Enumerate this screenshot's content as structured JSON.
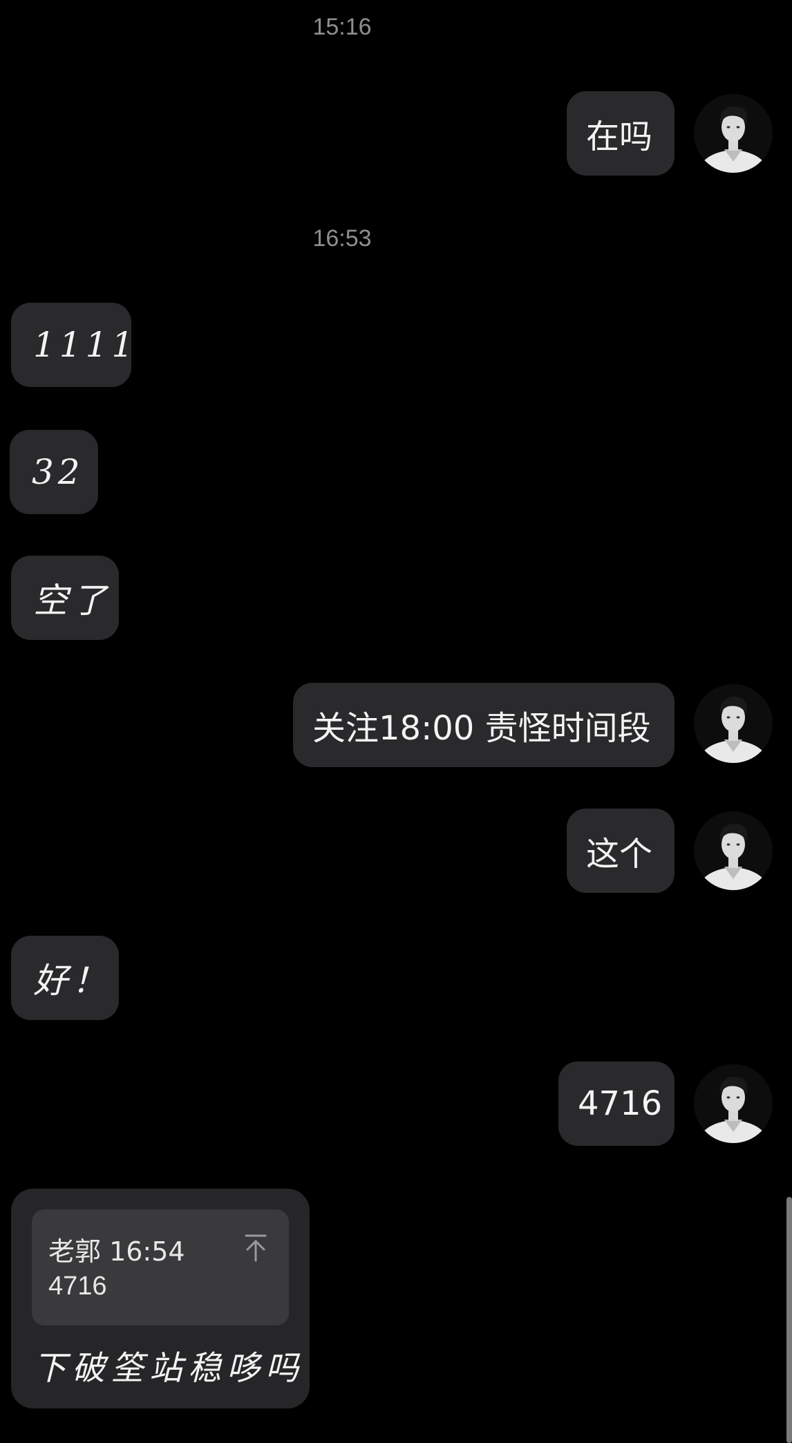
{
  "timestamps": [
    "15:16",
    "16:53"
  ],
  "messages": [
    {
      "dir": "out",
      "text": "在吗"
    },
    {
      "dir": "in",
      "text": "1111"
    },
    {
      "dir": "in",
      "text": "32"
    },
    {
      "dir": "in",
      "text": "空了"
    },
    {
      "dir": "out",
      "text": "关注18:00 责怪时间段"
    },
    {
      "dir": "out",
      "text": "这个"
    },
    {
      "dir": "in",
      "text": "好！"
    },
    {
      "dir": "out",
      "text": "4716"
    }
  ],
  "quote": {
    "header": "老郭 16:54",
    "body": "4716",
    "reply": "下破筌站稳哆吗",
    "icon": "pin-to-top-icon"
  },
  "avatar_icon": "user-avatar-icon",
  "colors": {
    "background": "#000000",
    "bubble": "#2a2a2c",
    "timestamp": "#8e8e93"
  }
}
